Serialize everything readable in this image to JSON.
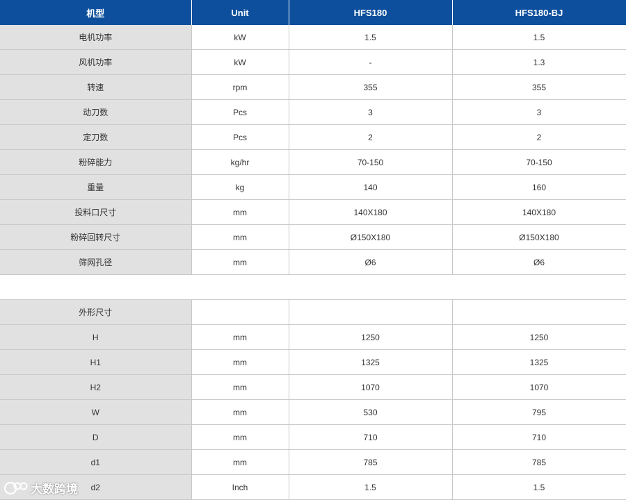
{
  "headers": [
    "机型",
    "Unit",
    "HFS180",
    "HFS180-BJ"
  ],
  "rows_main": [
    {
      "label": "电机功率",
      "unit": "kW",
      "hfs180": "1.5",
      "hfs180bj": "1.5"
    },
    {
      "label": "风机功率",
      "unit": "kW",
      "hfs180": "-",
      "hfs180bj": "1.3"
    },
    {
      "label": "转速",
      "unit": "rpm",
      "hfs180": "355",
      "hfs180bj": "355"
    },
    {
      "label": "动刀数",
      "unit": "Pcs",
      "hfs180": "3",
      "hfs180bj": "3"
    },
    {
      "label": "定刀数",
      "unit": "Pcs",
      "hfs180": "2",
      "hfs180bj": "2"
    },
    {
      "label": "粉碎能力",
      "unit": "kg/hr",
      "hfs180": "70-150",
      "hfs180bj": "70-150"
    },
    {
      "label": "重量",
      "unit": "kg",
      "hfs180": "140",
      "hfs180bj": "160"
    },
    {
      "label": "投料口尺寸",
      "unit": "mm",
      "hfs180": "140X180",
      "hfs180bj": "140X180"
    },
    {
      "label": "粉碎回转尺寸",
      "unit": "mm",
      "hfs180": "Ø150X180",
      "hfs180bj": "Ø150X180"
    },
    {
      "label": "筛网孔径",
      "unit": "mm",
      "hfs180": "Ø6",
      "hfs180bj": "Ø6"
    }
  ],
  "dimensions_title": "外形尺寸",
  "rows_dims": [
    {
      "label": "H",
      "unit": "mm",
      "hfs180": "1250",
      "hfs180bj": "1250"
    },
    {
      "label": "H1",
      "unit": "mm",
      "hfs180": "1325",
      "hfs180bj": "1325"
    },
    {
      "label": "H2",
      "unit": "mm",
      "hfs180": "1070",
      "hfs180bj": "1070"
    },
    {
      "label": "W",
      "unit": "mm",
      "hfs180": "530",
      "hfs180bj": "795"
    },
    {
      "label": "D",
      "unit": "mm",
      "hfs180": "710",
      "hfs180bj": "710"
    },
    {
      "label": "d1",
      "unit": "mm",
      "hfs180": "785",
      "hfs180bj": "785"
    },
    {
      "label": "d2",
      "unit": "Inch",
      "hfs180": "1.5",
      "hfs180bj": "1.5"
    }
  ],
  "watermark": "大数跨境",
  "colors": {
    "header_bg": "#0d4f9d",
    "label_bg": "#e1e1e1",
    "border": "#c8c8c8"
  }
}
